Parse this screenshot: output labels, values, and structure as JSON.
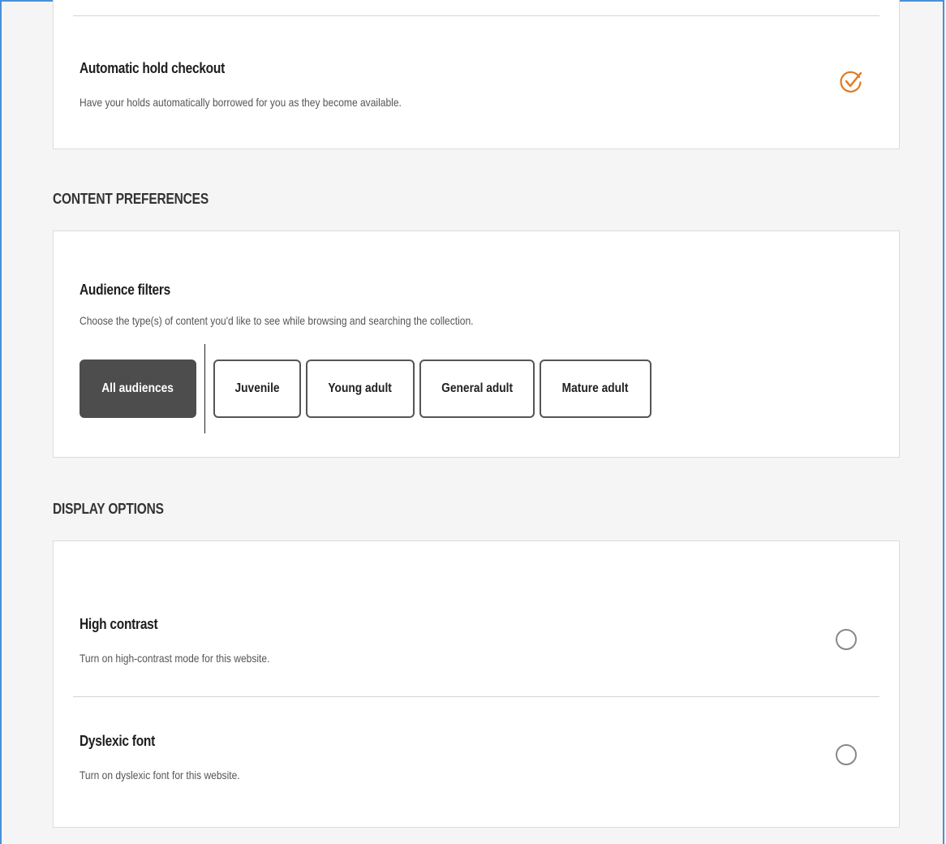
{
  "lending": {
    "auto_hold": {
      "title": "Automatic hold checkout",
      "description": "Have your holds automatically borrowed for you as they become available.",
      "enabled": true
    }
  },
  "content_preferences": {
    "heading": "CONTENT PREFERENCES",
    "audience": {
      "title": "Audience filters",
      "description": "Choose the type(s) of content you'd like to see while browsing and searching the collection.",
      "options": [
        {
          "label": "All audiences",
          "selected": true
        },
        {
          "label": "Juvenile",
          "selected": false
        },
        {
          "label": "Young adult",
          "selected": false
        },
        {
          "label": "General adult",
          "selected": false
        },
        {
          "label": "Mature adult",
          "selected": false
        }
      ]
    }
  },
  "display_options": {
    "heading": "DISPLAY OPTIONS",
    "high_contrast": {
      "title": "High contrast",
      "description": "Turn on high-contrast mode for this website.",
      "enabled": false
    },
    "dyslexic_font": {
      "title": "Dyslexic font",
      "description": "Turn on dyslexic font for this website.",
      "enabled": false
    }
  },
  "colors": {
    "accent": "#e07a1f",
    "selected_chip": "#4d4d4d",
    "frame_border": "#4a90d9"
  },
  "icons": {
    "enabled_toggle": "check-circle-icon",
    "disabled_toggle": "empty-circle-icon"
  }
}
